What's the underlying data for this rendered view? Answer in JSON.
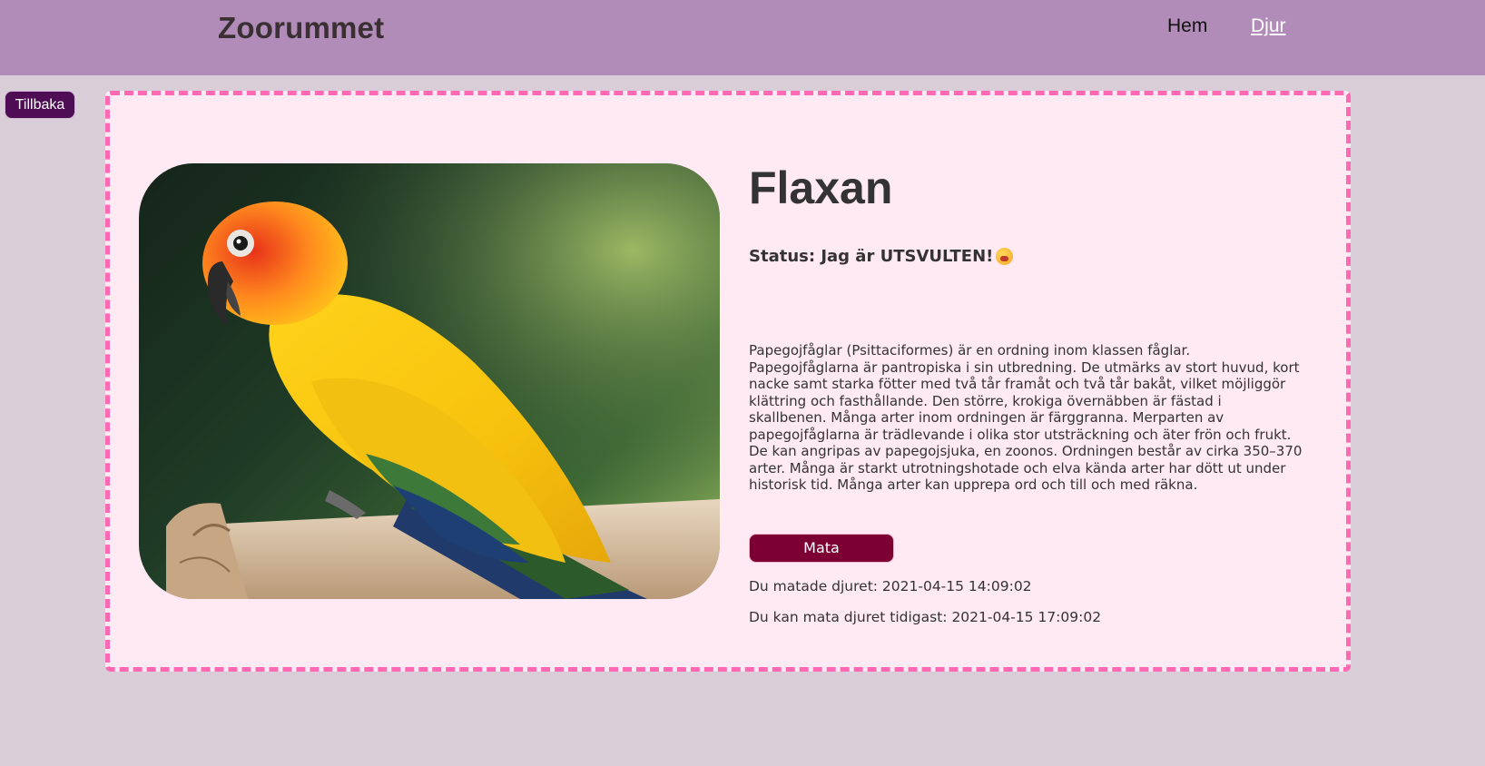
{
  "header": {
    "brand": "Zoorummet",
    "nav": [
      {
        "label": "Hem"
      },
      {
        "label": "Djur"
      }
    ]
  },
  "back_button": "Tillbaka",
  "animal": {
    "name": "Flaxan",
    "status": "Status: Jag är UTSVULTEN!",
    "status_icon": "hungry-face-emoji",
    "image_alt": "parrot-photo",
    "description": "Papegojfåglar (Psittaciformes) är en ordning inom klassen fåglar. Papegojfåglarna är pantropiska i sin utbredning. De utmärks av stort huvud, kort nacke samt starka fötter med två tår framåt och två tår bakåt, vilket möjliggör klättring och fasthållande. Den större, krokiga övernäbben är fästad i skallbenen. Många arter inom ordningen är färggranna. Merparten av papegojfåglarna är trädlevande i olika stor utsträckning och äter frön och frukt. De kan angripas av papegojsjuka, en zoonos. Ordningen består av cirka 350–370 arter. Många är starkt utrotningshotade och elva kända arter har dött ut under historisk tid. Många arter kan upprepa ord och till och med räkna.",
    "feed_button": "Mata",
    "fed_text": "Du matade djuret: 2021-04-15 14:09:02",
    "next_feed_text": "Du kan mata djuret tidigast: 2021-04-15 17:09:02"
  },
  "colors": {
    "header_bg": "#b28cb9",
    "page_bg": "#d9cdd8",
    "card_bg": "#ffeaf4",
    "card_border": "#ff69b4",
    "back_button_bg": "#4e0d54",
    "feed_button_bg": "#7c0033"
  }
}
